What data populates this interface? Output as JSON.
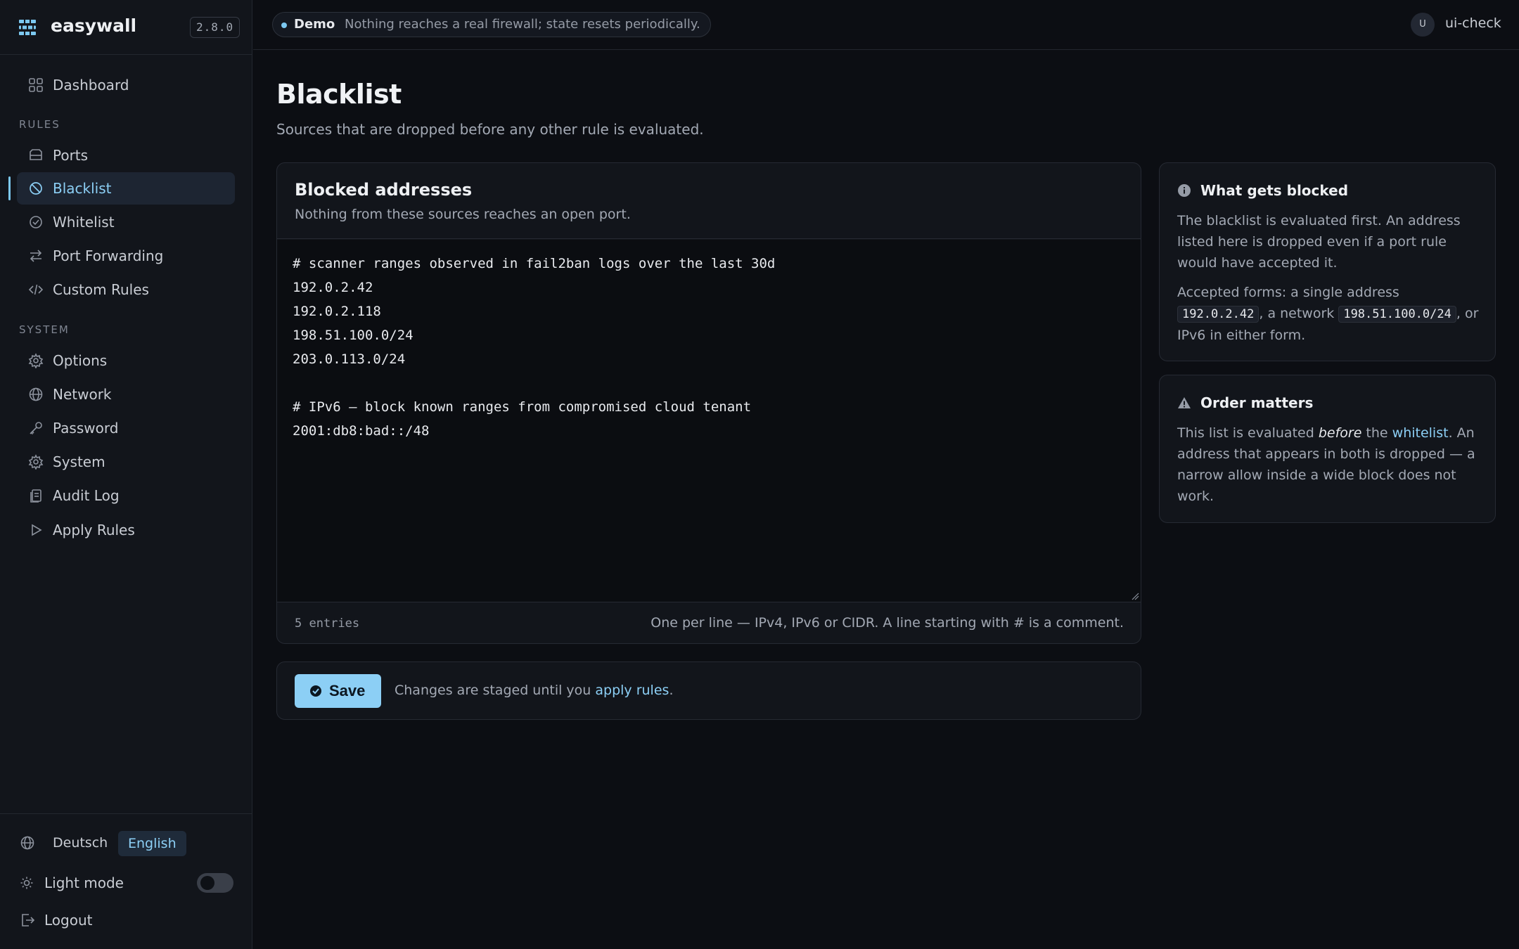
{
  "app": {
    "name": "easywall",
    "version": "2.8.0"
  },
  "topbar": {
    "demo_tag": "Demo",
    "demo_text": "Nothing reaches a real firewall; state resets periodically.",
    "avatar_initial": "U",
    "user": "ui-check"
  },
  "sidebar": {
    "dashboard": "Dashboard",
    "rules_label": "RULES",
    "rules": [
      "Ports",
      "Blacklist",
      "Whitelist",
      "Port Forwarding",
      "Custom Rules"
    ],
    "system_label": "SYSTEM",
    "system": [
      "Options",
      "Network",
      "Password",
      "System",
      "Audit Log",
      "Apply Rules"
    ],
    "active": "Blacklist",
    "lang_de": "Deutsch",
    "lang_en": "English",
    "light_mode": "Light mode",
    "logout": "Logout"
  },
  "page": {
    "title": "Blacklist",
    "subtitle": "Sources that are dropped before any other rule is evaluated."
  },
  "editor": {
    "title": "Blocked addresses",
    "subtitle": "Nothing from these sources reaches an open port.",
    "content": "# scanner ranges observed in fail2ban logs over the last 30d\n192.0.2.42\n192.0.2.118\n198.51.100.0/24\n203.0.113.0/24\n\n# IPv6 — block known ranges from compromised cloud tenant\n2001:db8:bad::/48",
    "entries": "5 entries",
    "hint": "One per line — IPv4, IPv6 or CIDR. A line starting with # is a comment."
  },
  "save": {
    "label": "Save",
    "note_pre": "Changes are staged until you ",
    "note_link": "apply rules",
    "note_post": "."
  },
  "info": {
    "title": "What gets blocked",
    "p1": "The blacklist is evaluated first. An address listed here is dropped even if a port rule would have accepted it.",
    "p2_pre": "Accepted forms: a single address ",
    "p2_code1": "192.0.2.42",
    "p2_mid": ", a network ",
    "p2_code2": "198.51.100.0/24",
    "p2_post": ", or IPv6 in either form."
  },
  "order": {
    "title": "Order matters",
    "pre": "This list is evaluated ",
    "em": "before",
    "mid": " the ",
    "link": "whitelist",
    "post": ". An address that appears in both is dropped — a narrow allow inside a wide block does not work."
  },
  "colors": {
    "accent": "#8ccff5",
    "background": "#0c0e13",
    "surface": "#12151b"
  }
}
